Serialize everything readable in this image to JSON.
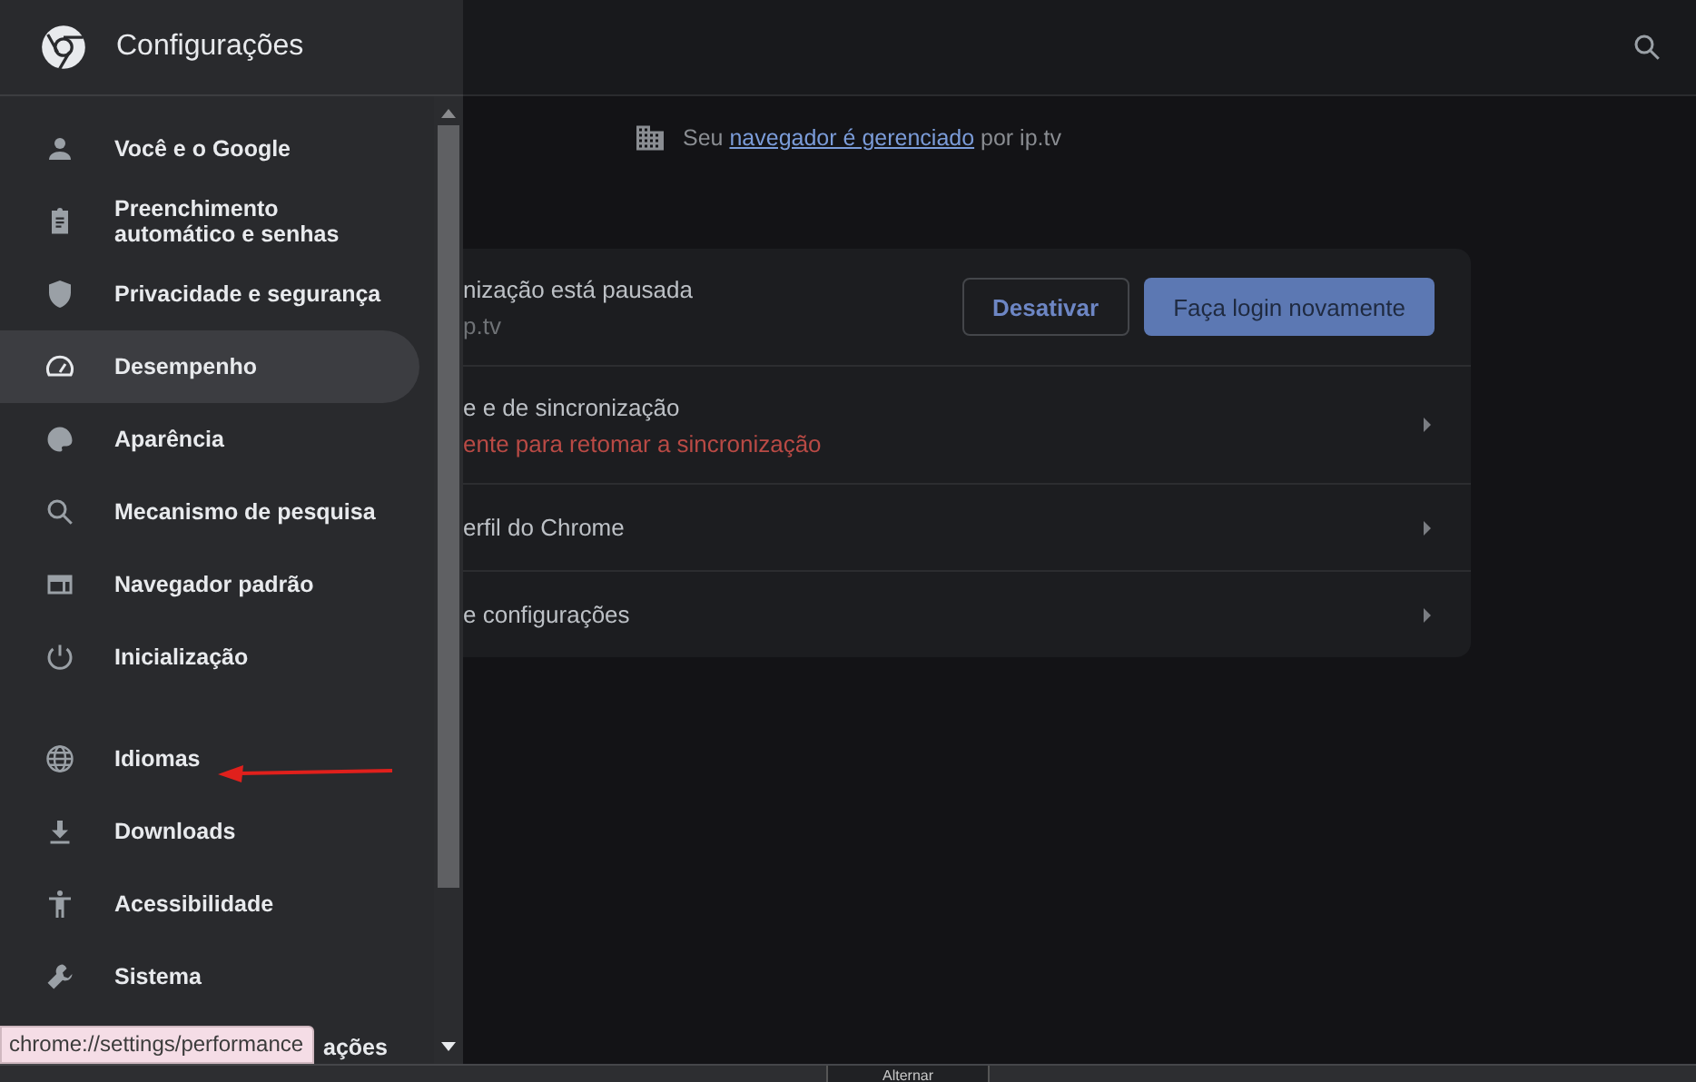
{
  "sidebar": {
    "title": "Configurações",
    "groups": [
      [
        {
          "label": "Você e o Google",
          "selected": false
        },
        {
          "label": "Preenchimento automático e senhas",
          "selected": false
        },
        {
          "label": "Privacidade e segurança",
          "selected": false
        },
        {
          "label": "Desempenho",
          "selected": true
        },
        {
          "label": "Aparência",
          "selected": false
        },
        {
          "label": "Mecanismo de pesquisa",
          "selected": false
        },
        {
          "label": "Navegador padrão",
          "selected": false
        },
        {
          "label": "Inicialização",
          "selected": false
        }
      ],
      [
        {
          "label": "Idiomas",
          "selected": false
        },
        {
          "label": "Downloads",
          "selected": false
        },
        {
          "label": "Acessibilidade",
          "selected": false
        },
        {
          "label": "Sistema",
          "selected": false
        },
        {
          "label": "ações",
          "selected": false
        }
      ]
    ]
  },
  "status_tooltip": "chrome://settings/performance",
  "managed_notice": {
    "before": "Seu ",
    "link": "navegador é gerenciado",
    "after": " por ip.tv"
  },
  "sync_card": {
    "title": "nização está pausada",
    "subtitle": "p.tv",
    "buttons": [
      {
        "label": "Desativar",
        "kind": "outline"
      },
      {
        "label": "Faça login novamente",
        "kind": "primary"
      }
    ],
    "rows": [
      {
        "title": "e e de sincronização",
        "error": "ente para retomar a sincronização"
      },
      {
        "title": "erfil do Chrome"
      },
      {
        "title": "e configurações"
      }
    ]
  },
  "bottom_bar": {
    "button": "Alternar"
  }
}
